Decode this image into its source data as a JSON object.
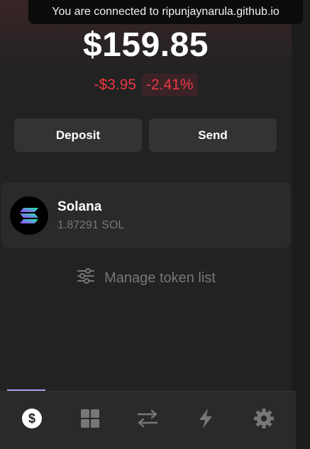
{
  "tooltip": {
    "text": "You are connected to ripunjaynarula.github.io"
  },
  "wallet": {
    "balance": "$159.85",
    "change_amount": "-$3.95",
    "change_percent": "-2.41%"
  },
  "actions": {
    "deposit_label": "Deposit",
    "send_label": "Send"
  },
  "tokens": [
    {
      "name": "Solana",
      "amount": "1.87291 SOL",
      "icon": "solana-logo-icon"
    }
  ],
  "manage": {
    "label": "Manage token list",
    "icon": "sliders-icon"
  },
  "nav": {
    "active_tab": "wallet",
    "tabs": [
      {
        "id": "wallet",
        "icon": "dollar-circle-icon"
      },
      {
        "id": "collectibles",
        "icon": "grid-icon"
      },
      {
        "id": "swap",
        "icon": "swap-arrows-icon"
      },
      {
        "id": "activity",
        "icon": "lightning-icon"
      },
      {
        "id": "settings",
        "icon": "gear-icon"
      }
    ]
  },
  "colors": {
    "background": "#222222",
    "negative": "#eb3742",
    "negative_badge_bg": "#3a2327",
    "button_bg": "#333333",
    "card_bg": "#2a2a2a",
    "muted_text": "#777777",
    "accent": "#ab9ff2"
  }
}
